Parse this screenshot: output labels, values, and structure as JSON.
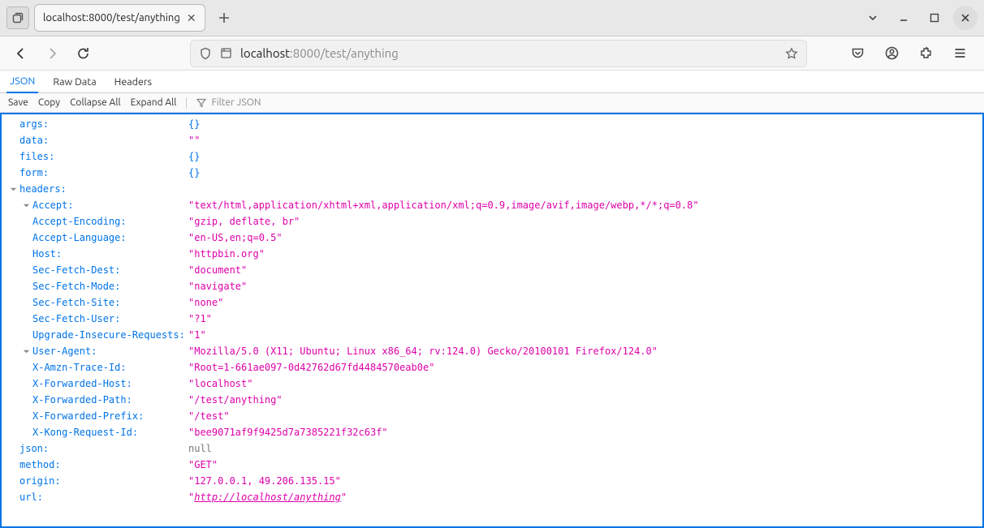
{
  "window": {
    "tab_title": "localhost:8000/test/anything"
  },
  "urlbar": {
    "host": "localhost",
    "rest": ":8000/test/anything"
  },
  "viewer": {
    "tabs": {
      "json": "JSON",
      "raw": "Raw Data",
      "headers": "Headers"
    },
    "toolbar": {
      "save": "Save",
      "copy": "Copy",
      "collapse": "Collapse All",
      "expand": "Expand All",
      "filter_placeholder": "Filter JSON"
    }
  },
  "json": {
    "args_key": "args",
    "args_val": "{}",
    "data_key": "data",
    "data_val": "\"\"",
    "files_key": "files",
    "files_val": "{}",
    "form_key": "form",
    "form_val": "{}",
    "headers_key": "headers",
    "headers": {
      "Accept_key": "Accept",
      "Accept_val": "\"text/html,application/xhtml+xml,application/xml;q=0.9,image/avif,image/webp,*/*;q=0.8\"",
      "AcceptEncoding_key": "Accept-Encoding",
      "AcceptEncoding_val": "\"gzip, deflate, br\"",
      "AcceptLanguage_key": "Accept-Language",
      "AcceptLanguage_val": "\"en-US,en;q=0.5\"",
      "Host_key": "Host",
      "Host_val": "\"httpbin.org\"",
      "SecFetchDest_key": "Sec-Fetch-Dest",
      "SecFetchDest_val": "\"document\"",
      "SecFetchMode_key": "Sec-Fetch-Mode",
      "SecFetchMode_val": "\"navigate\"",
      "SecFetchSite_key": "Sec-Fetch-Site",
      "SecFetchSite_val": "\"none\"",
      "SecFetchUser_key": "Sec-Fetch-User",
      "SecFetchUser_val": "\"?1\"",
      "UpgradeInsecure_key": "Upgrade-Insecure-Requests",
      "UpgradeInsecure_val": "\"1\"",
      "UserAgent_key": "User-Agent",
      "UserAgent_val": "\"Mozilla/5.0 (X11; Ubuntu; Linux x86_64; rv:124.0) Gecko/20100101 Firefox/124.0\"",
      "XAmznTraceId_key": "X-Amzn-Trace-Id",
      "XAmznTraceId_val": "\"Root=1-661ae097-0d42762d67fd4484570eab0e\"",
      "XForwardedHost_key": "X-Forwarded-Host",
      "XForwardedHost_val": "\"localhost\"",
      "XForwardedPath_key": "X-Forwarded-Path",
      "XForwardedPath_val": "\"/test/anything\"",
      "XForwardedPrefix_key": "X-Forwarded-Prefix",
      "XForwardedPrefix_val": "\"/test\"",
      "XKongRequestId_key": "X-Kong-Request-Id",
      "XKongRequestId_val": "\"bee9071af9f9425d7a7385221f32c63f\""
    },
    "json_key": "json",
    "json_val": "null",
    "method_key": "method",
    "method_val": "\"GET\"",
    "origin_key": "origin",
    "origin_val": "\"127.0.0.1, 49.206.135.15\"",
    "url_key": "url",
    "url_link": "http://localhost/anything"
  }
}
